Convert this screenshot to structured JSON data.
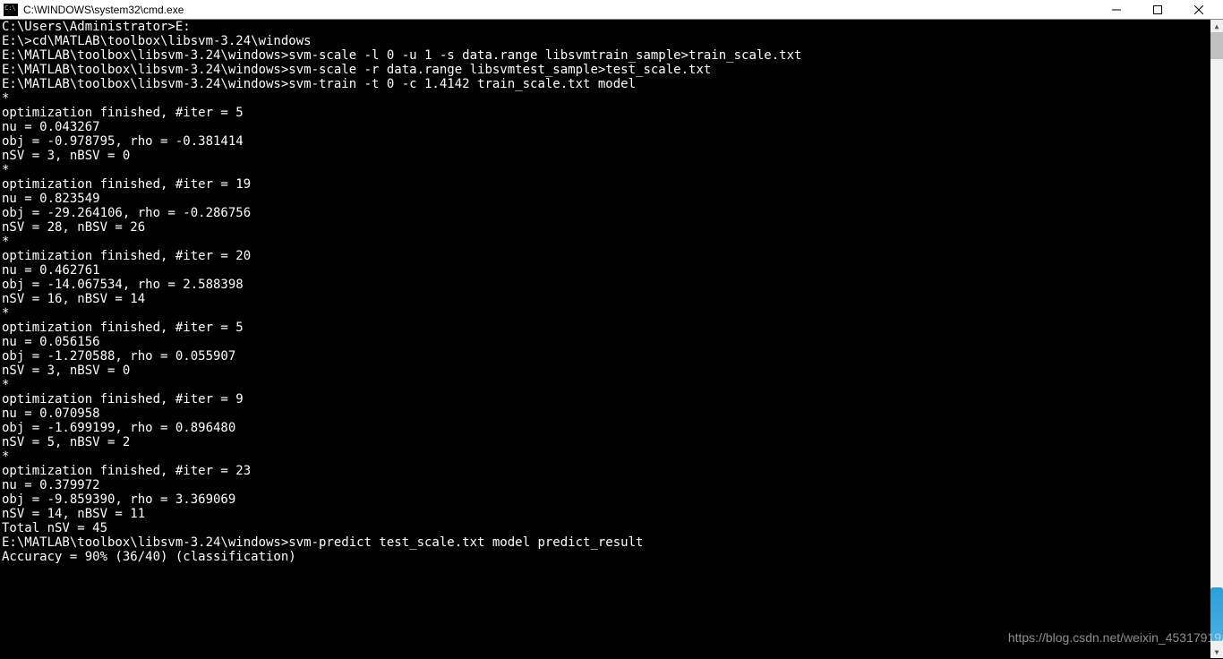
{
  "window": {
    "title": "C:\\WINDOWS\\system32\\cmd.exe"
  },
  "terminal": {
    "lines": [
      "C:\\Users\\Administrator>E:",
      "",
      "E:\\>cd\\MATLAB\\toolbox\\libsvm-3.24\\windows",
      "",
      "E:\\MATLAB\\toolbox\\libsvm-3.24\\windows>svm-scale -l 0 -u 1 -s data.range libsvmtrain_sample>train_scale.txt",
      "",
      "E:\\MATLAB\\toolbox\\libsvm-3.24\\windows>svm-scale -r data.range libsvmtest_sample>test_scale.txt",
      "",
      "E:\\MATLAB\\toolbox\\libsvm-3.24\\windows>svm-train -t 0 -c 1.4142 train_scale.txt model",
      "*",
      "optimization finished, #iter = 5",
      "nu = 0.043267",
      "obj = -0.978795, rho = -0.381414",
      "nSV = 3, nBSV = 0",
      "*",
      "optimization finished, #iter = 19",
      "nu = 0.823549",
      "obj = -29.264106, rho = -0.286756",
      "nSV = 28, nBSV = 26",
      "*",
      "optimization finished, #iter = 20",
      "nu = 0.462761",
      "obj = -14.067534, rho = 2.588398",
      "nSV = 16, nBSV = 14",
      "*",
      "optimization finished, #iter = 5",
      "nu = 0.056156",
      "obj = -1.270588, rho = 0.055907",
      "nSV = 3, nBSV = 0",
      "*",
      "optimization finished, #iter = 9",
      "nu = 0.070958",
      "obj = -1.699199, rho = 0.896480",
      "nSV = 5, nBSV = 2",
      "*",
      "optimization finished, #iter = 23",
      "nu = 0.379972",
      "obj = -9.859390, rho = 3.369069",
      "nSV = 14, nBSV = 11",
      "Total nSV = 45",
      "",
      "E:\\MATLAB\\toolbox\\libsvm-3.24\\windows>svm-predict test_scale.txt model predict_result",
      "Accuracy = 90% (36/40) (classification)"
    ]
  },
  "watermark": "https://blog.csdn.net/weixin_45317919"
}
